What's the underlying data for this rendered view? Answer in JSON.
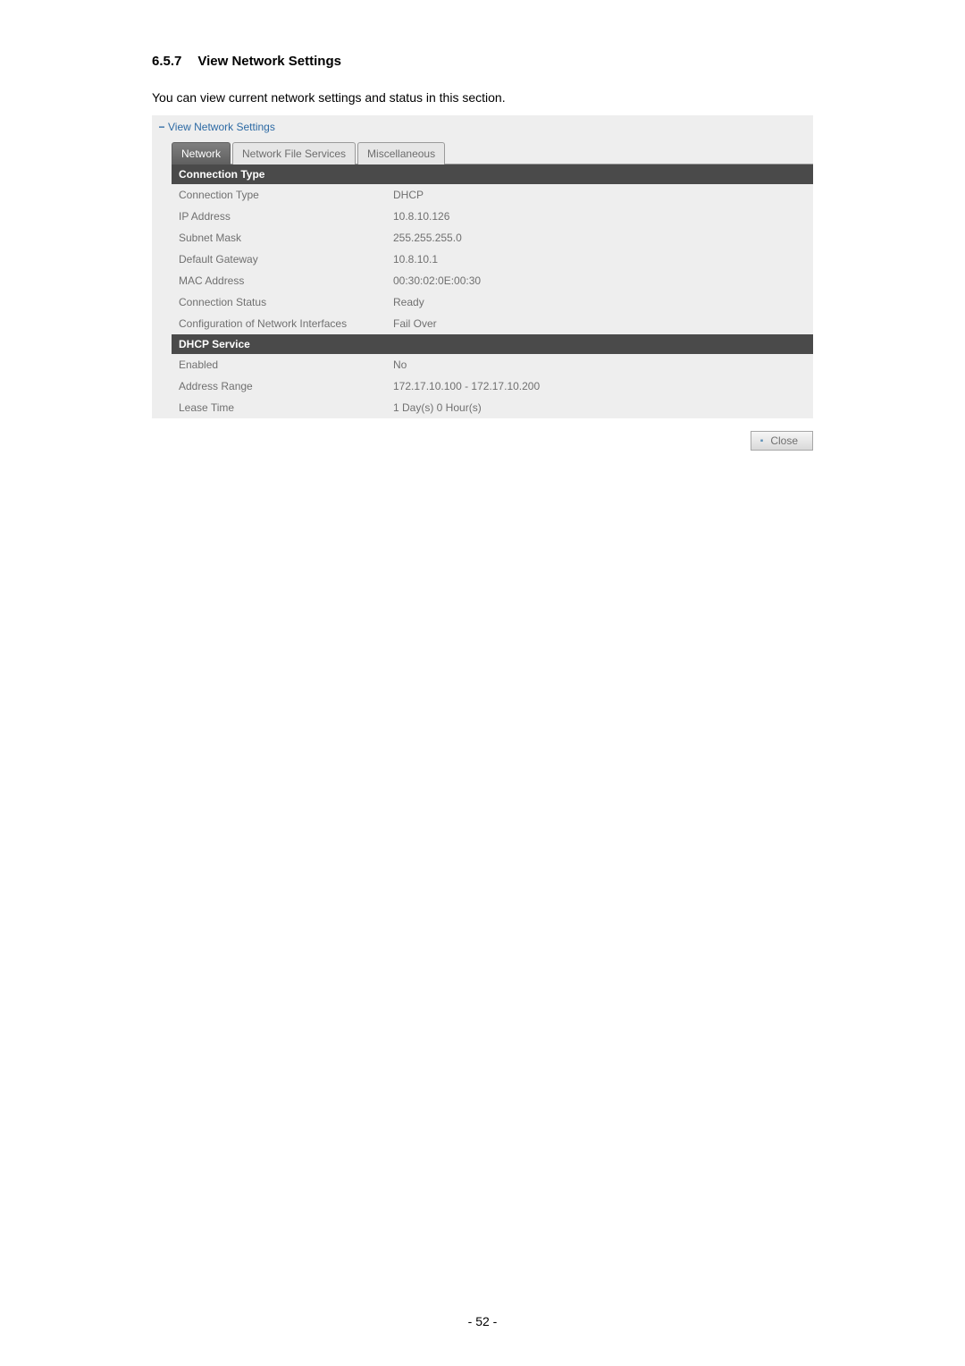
{
  "heading": {
    "number": "6.5.7",
    "title": "View Network Settings"
  },
  "intro": "You can view current network settings and status in this section.",
  "panel": {
    "toggle": "−",
    "title": "View Network Settings",
    "tabs": {
      "network": "Network",
      "file_services": "Network File Services",
      "misc": "Miscellaneous"
    },
    "section_connection": "Connection Type",
    "rows_conn": {
      "connection_type": {
        "label": "Connection Type",
        "value": "DHCP"
      },
      "ip_address": {
        "label": "IP Address",
        "value": "10.8.10.126"
      },
      "subnet_mask": {
        "label": "Subnet Mask",
        "value": "255.255.255.0"
      },
      "gateway": {
        "label": "Default Gateway",
        "value": "10.8.10.1"
      },
      "mac": {
        "label": "MAC Address",
        "value": "00:30:02:0E:00:30"
      },
      "status": {
        "label": "Connection Status",
        "value": "Ready"
      },
      "config_if": {
        "label": "Configuration of Network Interfaces",
        "value": "Fail Over"
      }
    },
    "section_dhcp": "DHCP Service",
    "rows_dhcp": {
      "enabled": {
        "label": "Enabled",
        "value": "No"
      },
      "range": {
        "label": "Address Range",
        "value": "172.17.10.100 - 172.17.10.200"
      },
      "lease": {
        "label": "Lease Time",
        "value": "1 Day(s) 0 Hour(s)"
      }
    },
    "close_label": "Close"
  },
  "footer": "- 52 -"
}
